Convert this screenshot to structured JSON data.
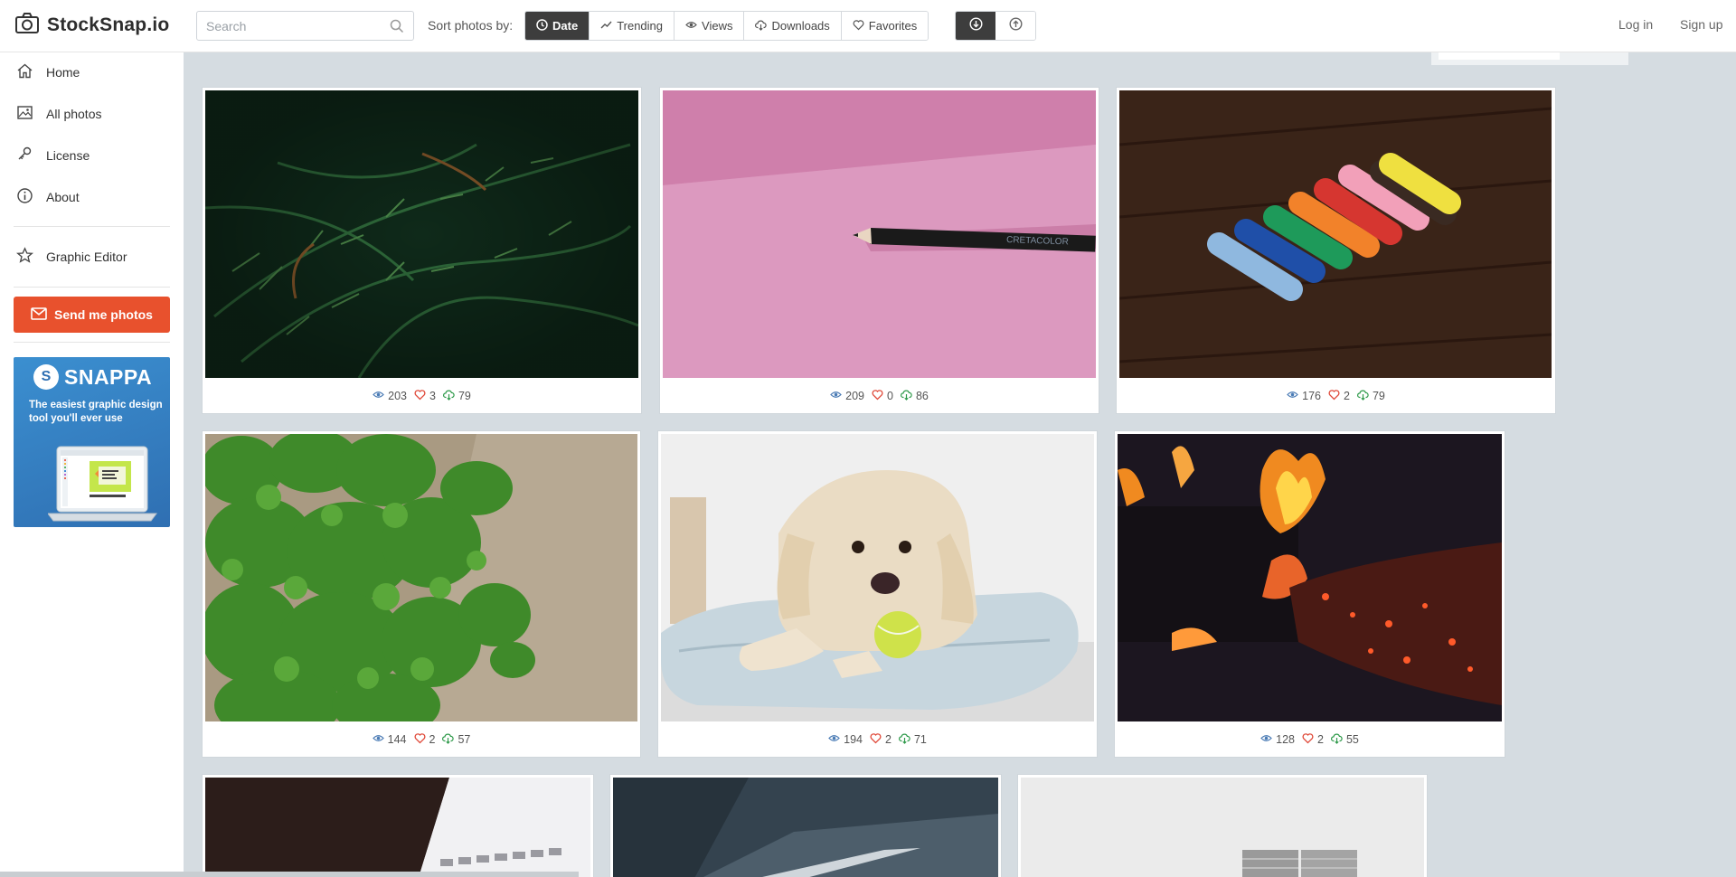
{
  "brand": {
    "name": "StockSnap.io",
    "logo_icon": "camera-icon"
  },
  "search": {
    "placeholder": "Search",
    "value": ""
  },
  "sort": {
    "label": "Sort photos by:",
    "options": [
      {
        "label": "Date",
        "icon": "clock-icon",
        "active": true
      },
      {
        "label": "Trending",
        "icon": "trend-icon",
        "active": false
      },
      {
        "label": "Views",
        "icon": "eye-icon",
        "active": false
      },
      {
        "label": "Downloads",
        "icon": "cloud-download-icon",
        "active": false
      },
      {
        "label": "Favorites",
        "icon": "heart-icon",
        "active": false
      }
    ]
  },
  "direction": {
    "options": [
      "download-circle-icon",
      "upload-circle-icon"
    ],
    "active": 0
  },
  "auth": {
    "login": "Log in",
    "signup": "Sign up"
  },
  "sidebar": {
    "items": [
      {
        "label": "Home",
        "icon": "home-icon"
      },
      {
        "label": "All photos",
        "icon": "image-icon"
      },
      {
        "label": "License",
        "icon": "key-icon"
      },
      {
        "label": "About",
        "icon": "info-icon"
      }
    ],
    "editor": {
      "label": "Graphic Editor",
      "icon": "star-icon"
    },
    "send_button": "Send me photos"
  },
  "ad": {
    "brand": "SNAPPA",
    "mark": "S",
    "tagline": "The easiest graphic design tool you'll ever use"
  },
  "photos": [
    {
      "subject": "green conifer branches",
      "views": "203",
      "likes": "3",
      "downloads": "79"
    },
    {
      "subject": "pencil on pink paper",
      "views": "209",
      "likes": "0",
      "downloads": "86"
    },
    {
      "subject": "spools of colored thread",
      "views": "176",
      "likes": "2",
      "downloads": "79"
    },
    {
      "subject": "green leaves on beige",
      "views": "144",
      "likes": "2",
      "downloads": "57"
    },
    {
      "subject": "golden retriever with tennis ball",
      "views": "194",
      "likes": "2",
      "downloads": "71"
    },
    {
      "subject": "burning firewood",
      "views": "128",
      "likes": "2",
      "downloads": "55"
    },
    {
      "subject": "laptop keyboard"
    },
    {
      "subject": "open laptop dark"
    },
    {
      "subject": "metal cans on white"
    }
  ],
  "colors": {
    "accent": "#e8512d",
    "active_sort": "#3d3d3d",
    "page_bg": "#d5dce1",
    "ad_blue": "#2f6fb2"
  }
}
